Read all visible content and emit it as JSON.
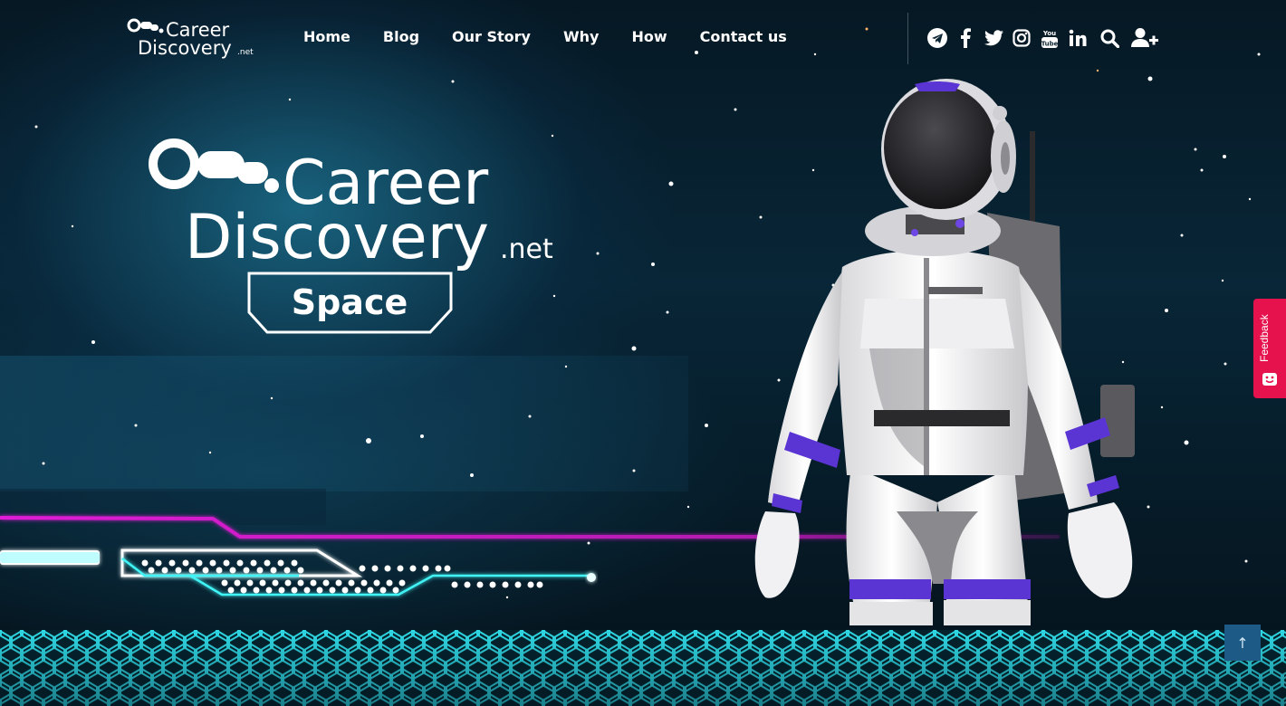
{
  "brand": {
    "logo_line1": "Career",
    "logo_line2": "Discovery",
    "logo_suffix": ".net",
    "badge": "Space"
  },
  "nav": {
    "items": [
      {
        "label": "Home"
      },
      {
        "label": "Blog"
      },
      {
        "label": "Our Story"
      },
      {
        "label": "Why"
      },
      {
        "label": "How"
      },
      {
        "label": "Contact us"
      }
    ]
  },
  "social_icons": [
    "telegram-icon",
    "facebook-icon",
    "twitter-icon",
    "instagram-icon",
    "youtube-icon",
    "linkedin-icon",
    "search-icon",
    "add-user-icon"
  ],
  "feedback": {
    "label": "Feedback"
  },
  "scroll_top": {
    "glyph": "↑"
  },
  "colors": {
    "accent_magenta": "#e01fd6",
    "accent_cyan": "#3ff3f5",
    "feedback_red": "#e5124e",
    "scroll_top_blue": "#1d5a86"
  }
}
